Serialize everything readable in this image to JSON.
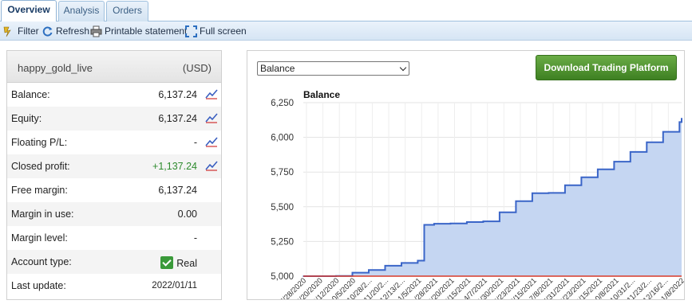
{
  "tabs": [
    {
      "label": "Overview",
      "active": true
    },
    {
      "label": "Analysis",
      "active": false
    },
    {
      "label": "Orders",
      "active": false
    }
  ],
  "toolbar": {
    "filter": "Filter",
    "refresh": "Refresh",
    "printable": "Printable statement",
    "fullscreen": "Full screen"
  },
  "account": {
    "name": "happy_gold_live",
    "currency": "(USD)",
    "rows": [
      {
        "label": "Balance:",
        "value": "6,137.24",
        "chart_icon": true
      },
      {
        "label": "Equity:",
        "value": "6,137.24",
        "chart_icon": true
      },
      {
        "label": "Floating P/L:",
        "value": "-",
        "chart_icon": true
      },
      {
        "label": "Closed profit:",
        "value": "+1,137.24",
        "chart_icon": true
      },
      {
        "label": "Free margin:",
        "value": "6,137.24",
        "chart_icon": false
      },
      {
        "label": "Margin in use:",
        "value": "0.00",
        "chart_icon": false
      },
      {
        "label": "Margin level:",
        "value": "-",
        "chart_icon": false
      },
      {
        "label": "Account type:",
        "value": "Real",
        "chart_icon": false
      },
      {
        "label": "Last update:",
        "value": "2022/01/11",
        "chart_icon": false
      }
    ]
  },
  "chart_select": {
    "selected": "Balance"
  },
  "download_button": "Download Trading Platform",
  "colors": {
    "fill": "#c5d6f2",
    "line": "#3a65c8",
    "baseline": "#d83a2a",
    "button": "#4f9630"
  },
  "chart_data": {
    "type": "area",
    "title": "Balance",
    "ylim": [
      5000,
      6250
    ],
    "yticks": [
      "6,250",
      "6,000",
      "5,750",
      "5,500",
      "5,250",
      "5,000"
    ],
    "xticks": [
      "7/28/2020",
      "8/20/2020",
      "9/12/2020",
      "10/5/2020",
      "10/28/2...",
      "11/20/2...",
      "12/13/2...",
      "1/5/2021",
      "1/28/2021",
      "2/20/2021",
      "3/15/2021",
      "4/7/2021",
      "4/30/2021",
      "5/23/2021",
      "6/15/2021",
      "7/8/2021",
      "7/31/2021",
      "8/23/2021",
      "9/15/2021",
      "10/8/2021",
      "10/31/2...",
      "11/23/2...",
      "12/16/2...",
      "1/8/2022"
    ],
    "x": [
      "7/28/2020",
      "9/12/2020",
      "10/5/2020",
      "10/28/2020",
      "11/20/2020",
      "12/13/2020",
      "1/5/2021",
      "1/14/2021",
      "1/28/2021",
      "2/20/2021",
      "3/15/2021",
      "4/7/2021",
      "4/30/2021",
      "5/23/2021",
      "6/15/2021",
      "7/8/2021",
      "7/31/2021",
      "8/23/2021",
      "9/15/2021",
      "10/8/2021",
      "10/31/2021",
      "11/23/2021",
      "12/16/2021",
      "1/8/2022",
      "1/11/2022"
    ],
    "values": [
      5000,
      5002,
      5025,
      5045,
      5075,
      5095,
      5112,
      5370,
      5378,
      5380,
      5390,
      5395,
      5460,
      5540,
      5598,
      5600,
      5655,
      5712,
      5770,
      5825,
      5895,
      5965,
      6040,
      6110,
      6137
    ]
  }
}
